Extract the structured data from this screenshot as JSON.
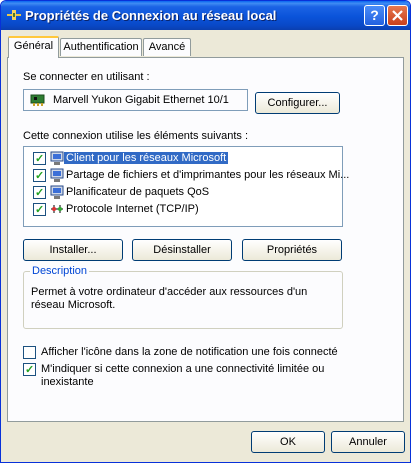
{
  "window": {
    "title": "Propriétés de Connexion au réseau local",
    "help_glyph": "?"
  },
  "tabs": [
    {
      "label": "Général"
    },
    {
      "label": "Authentification"
    },
    {
      "label": "Avancé"
    }
  ],
  "general": {
    "connect_using_label": "Se connecter en utilisant :",
    "adapter_name": "Marvell Yukon Gigabit Ethernet 10/1",
    "configure_button": "Configurer...",
    "components_label": "Cette connexion utilise les éléments suivants :",
    "components": [
      {
        "label": "Client pour les réseaux Microsoft",
        "checked": true,
        "selected": true,
        "icon": "network-client-icon"
      },
      {
        "label": "Partage de fichiers et d'imprimantes pour les réseaux Mi...",
        "checked": true,
        "selected": false,
        "icon": "file-printer-sharing-icon"
      },
      {
        "label": "Planificateur de paquets QoS",
        "checked": true,
        "selected": false,
        "icon": "qos-scheduler-icon"
      },
      {
        "label": "Protocole Internet (TCP/IP)",
        "checked": true,
        "selected": false,
        "icon": "protocol-icon"
      }
    ],
    "install_button": "Installer...",
    "uninstall_button": "Désinstaller",
    "properties_button": "Propriétés",
    "description_title": "Description",
    "description_text": "Permet à votre ordinateur d'accéder aux ressources d'un réseau Microsoft.",
    "show_icon_checkbox": {
      "label": "Afficher l'icône dans la zone de notification une fois connecté",
      "checked": false
    },
    "notify_checkbox": {
      "label_line1": "M'indiquer si cette connexion a une connectivité limitée ou",
      "label_line2": "inexistante",
      "checked": true
    }
  },
  "footer": {
    "ok_button": "OK",
    "cancel_button": "Annuler"
  }
}
